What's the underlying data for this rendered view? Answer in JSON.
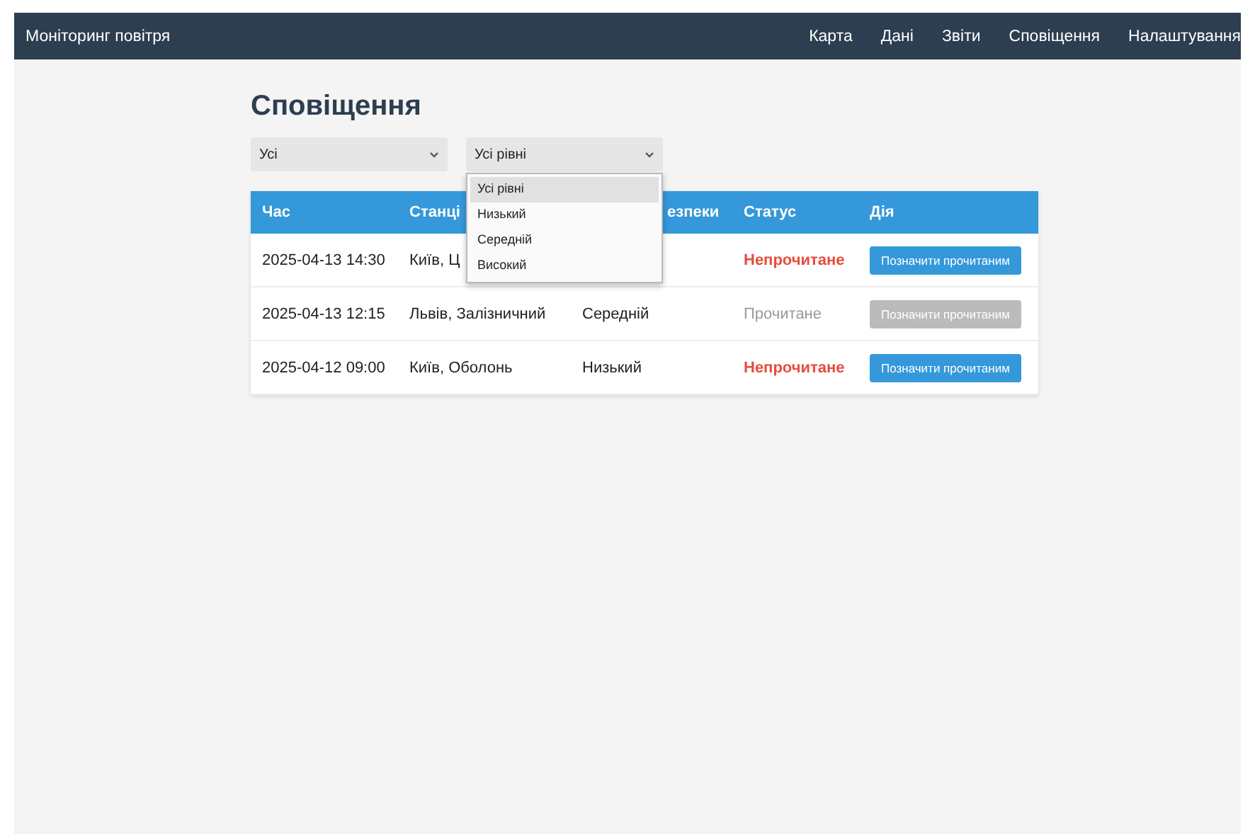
{
  "navbar": {
    "brand": "Моніторинг повітря",
    "links": [
      "Карта",
      "Дані",
      "Звіти",
      "Сповіщення",
      "Налаштування"
    ]
  },
  "page_title": "Сповіщення",
  "filters": [
    {
      "value": "Усі"
    },
    {
      "value": "Усі рівні",
      "options": [
        {
          "label": "Усі рівні",
          "selected": true
        },
        {
          "label": "Низький",
          "selected": false
        },
        {
          "label": "Середній",
          "selected": false
        },
        {
          "label": "Високий",
          "selected": false
        }
      ]
    }
  ],
  "table": {
    "columns": [
      "Час",
      "Станці",
      "езпеки",
      "Статус",
      "Дія"
    ],
    "rows": [
      {
        "time": "2025-04-13 14:30",
        "station": "Київ, Ц",
        "status": "Непрочитане",
        "read": false,
        "action": "Позначити прочитаним"
      },
      {
        "time": "2025-04-13 12:15",
        "station": "Львів, Залізничний",
        "level": "Середній",
        "status": "Прочитане",
        "read": true,
        "action": "Позначити прочитаним"
      },
      {
        "time": "2025-04-12 09:00",
        "station": "Київ, Оболонь",
        "level": "Низький",
        "status": "Непрочитане",
        "read": false,
        "action": "Позначити прочитаним"
      }
    ]
  }
}
